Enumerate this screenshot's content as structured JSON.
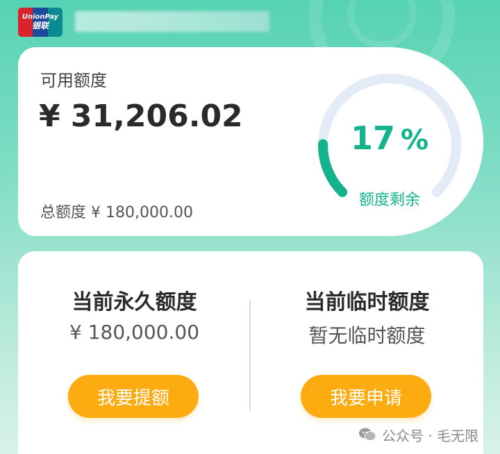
{
  "header": {
    "logo": {
      "icon": "unionpay-logo",
      "text_top": "UnionPay",
      "text_bottom": "银联"
    },
    "colors": {
      "bg_top": "#56d2b4",
      "bg_bottom": "#d8f2ea"
    }
  },
  "limit_card": {
    "available_label": "可用额度",
    "available_amount": "¥ 31,206.02",
    "total_label": "总额度 ¥ 180,000.00",
    "gauge": {
      "percent_value": "17",
      "percent_sign": "%",
      "caption": "额度剩余",
      "remaining_fraction": 0.17,
      "accent_color": "#13b38e",
      "track_color": "#e3ebf6"
    }
  },
  "quota_panel": {
    "permanent": {
      "title": "当前永久额度",
      "value": "¥ 180,000.00",
      "button_label": "我要提额"
    },
    "temporary": {
      "title": "当前临时额度",
      "value": "暂无临时额度",
      "button_label": "我要申请"
    },
    "button_color": "#fcab11"
  },
  "watermark": {
    "icon": "wechat-icon",
    "text": "公众号 · 毛无限"
  }
}
